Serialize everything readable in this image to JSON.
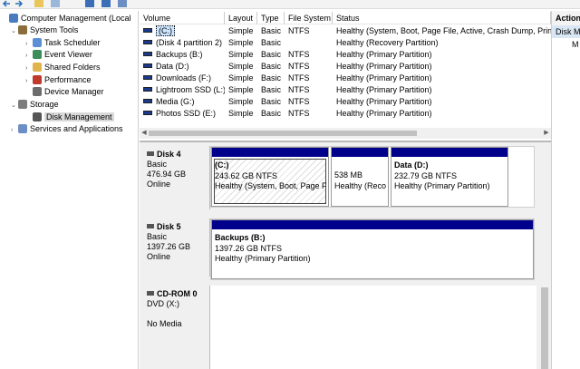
{
  "tree": {
    "items": [
      {
        "label": "Computer Management (Local",
        "level": 0,
        "icon": "computer-icon",
        "caret": ""
      },
      {
        "label": "System Tools",
        "level": 1,
        "icon": "tools-icon",
        "caret": "v"
      },
      {
        "label": "Task Scheduler",
        "level": 2,
        "icon": "clock-icon",
        "caret": ">"
      },
      {
        "label": "Event Viewer",
        "level": 2,
        "icon": "event-viewer-icon",
        "caret": ">"
      },
      {
        "label": "Shared Folders",
        "level": 2,
        "icon": "folder-icon",
        "caret": ">"
      },
      {
        "label": "Performance",
        "level": 2,
        "icon": "performance-icon",
        "caret": ">"
      },
      {
        "label": "Device Manager",
        "level": 2,
        "icon": "device-manager-icon",
        "caret": ""
      },
      {
        "label": "Storage",
        "level": 1,
        "icon": "storage-icon",
        "caret": "v"
      },
      {
        "label": "Disk Management",
        "level": 2,
        "icon": "disk-management-icon",
        "caret": "",
        "selected": true
      },
      {
        "label": "Services and Applications",
        "level": 1,
        "icon": "services-icon",
        "caret": ">"
      }
    ]
  },
  "volumes": {
    "headers": [
      "Volume",
      "Layout",
      "Type",
      "File System",
      "Status"
    ],
    "rows": [
      {
        "volume": "(C:)",
        "layout": "Simple",
        "type": "Basic",
        "fs": "NTFS",
        "status": "Healthy (System, Boot, Page File, Active, Crash Dump, Prin",
        "selected": true
      },
      {
        "volume": "(Disk 4 partition 2)",
        "layout": "Simple",
        "type": "Basic",
        "fs": "",
        "status": "Healthy (Recovery Partition)"
      },
      {
        "volume": "Backups (B:)",
        "layout": "Simple",
        "type": "Basic",
        "fs": "NTFS",
        "status": "Healthy (Primary Partition)"
      },
      {
        "volume": "Data (D:)",
        "layout": "Simple",
        "type": "Basic",
        "fs": "NTFS",
        "status": "Healthy (Primary Partition)"
      },
      {
        "volume": "Downloads (F:)",
        "layout": "Simple",
        "type": "Basic",
        "fs": "NTFS",
        "status": "Healthy (Primary Partition)"
      },
      {
        "volume": "Lightroom SSD (L:)",
        "layout": "Simple",
        "type": "Basic",
        "fs": "NTFS",
        "status": "Healthy (Primary Partition)"
      },
      {
        "volume": "Media (G:)",
        "layout": "Simple",
        "type": "Basic",
        "fs": "NTFS",
        "status": "Healthy (Primary Partition)"
      },
      {
        "volume": "Photos SSD (E:)",
        "layout": "Simple",
        "type": "Basic",
        "fs": "NTFS",
        "status": "Healthy (Primary Partition)"
      }
    ]
  },
  "disks": [
    {
      "name": "Disk 4",
      "kind": "Basic",
      "size": "476.94 GB",
      "state": "Online",
      "partitions": [
        {
          "name": "(C:)",
          "size": "243.62 GB NTFS",
          "status": "Healthy (System, Boot, Page F"
        },
        {
          "name": "",
          "size": "538 MB",
          "status": "Healthy (Reco"
        },
        {
          "name": "Data  (D:)",
          "size": "232.79 GB NTFS",
          "status": "Healthy (Primary Partition)"
        }
      ]
    },
    {
      "name": "Disk 5",
      "kind": "Basic",
      "size": "1397.26 GB",
      "state": "Online",
      "partitions": [
        {
          "name": "Backups  (B:)",
          "size": "1397.26 GB NTFS",
          "status": "Healthy (Primary Partition)"
        }
      ]
    },
    {
      "name": "CD-ROM 0",
      "kind": "DVD (X:)",
      "size": "",
      "state": "No Media",
      "partitions": []
    }
  ],
  "actions": {
    "header": "Action",
    "items": [
      "Disk M",
      "M"
    ]
  },
  "colors": {
    "partition_header": "#00008b",
    "selection": "#cde5ff"
  }
}
